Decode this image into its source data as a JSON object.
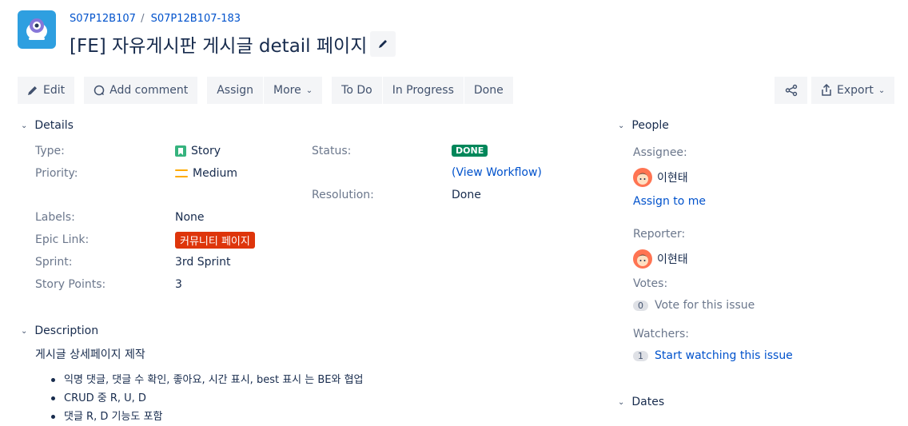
{
  "breadcrumbs": {
    "project": "S07P12B107",
    "separator": "/",
    "issue_key": "S07P12B107-183"
  },
  "issue": {
    "title": "[FE] 자유게시판 게시글 detail 페이지"
  },
  "toolbar": {
    "edit": "Edit",
    "comment": "Add comment",
    "assign": "Assign",
    "more": "More",
    "todo": "To Do",
    "in_progress": "In Progress",
    "done": "Done",
    "export": "Export"
  },
  "details": {
    "heading": "Details",
    "type_label": "Type:",
    "type_value": "Story",
    "priority_label": "Priority:",
    "priority_value": "Medium",
    "status_label": "Status:",
    "status_value": "DONE",
    "view_workflow": "(View Workflow)",
    "resolution_label": "Resolution:",
    "resolution_value": "Done",
    "labels_label": "Labels:",
    "labels_value": "None",
    "epic_label": "Epic Link:",
    "epic_value": "커뮤니티 페이지",
    "sprint_label": "Sprint:",
    "sprint_value": "3rd Sprint",
    "points_label": "Story Points:",
    "points_value": "3"
  },
  "description": {
    "heading": "Description",
    "intro": "게시글 상세페이지 제작",
    "items": [
      "익명 댓글, 댓글 수 확인, 좋아요, 시간 표시, best 표시 는 BE와 협업",
      "CRUD 중 R, U, D",
      "댓글 R, D 기능도 포함"
    ]
  },
  "people": {
    "heading": "People",
    "assignee_label": "Assignee:",
    "assignee_name": "이현태",
    "assign_to_me": "Assign to me",
    "reporter_label": "Reporter:",
    "reporter_name": "이현태",
    "votes_label": "Votes:",
    "votes_count": "0",
    "vote_text": "Vote for this issue",
    "watchers_label": "Watchers:",
    "watchers_count": "1",
    "watch_text": "Start watching this issue"
  },
  "dates": {
    "heading": "Dates"
  },
  "colors": {
    "link": "#0052cc",
    "done_lozenge": "#00875a",
    "epic": "#de350b",
    "story": "#36b37e",
    "priority": "#ffab00"
  }
}
